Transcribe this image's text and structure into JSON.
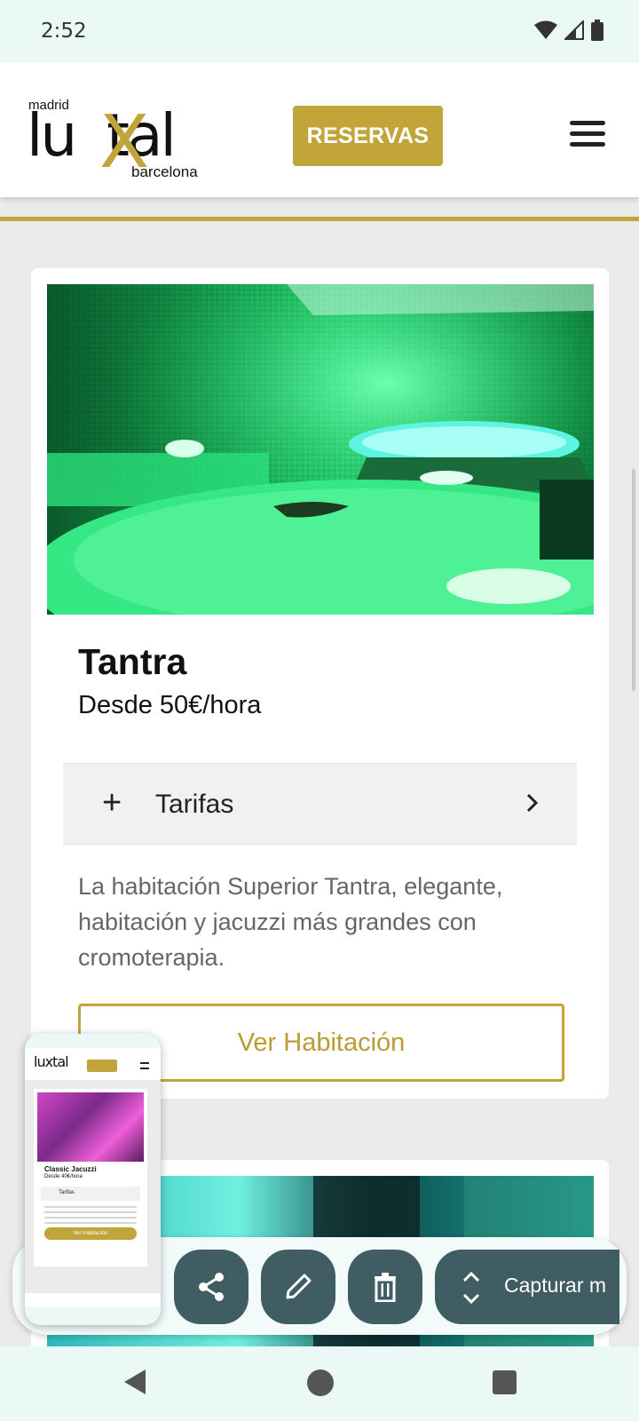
{
  "status_bar": {
    "time": "2:52"
  },
  "header": {
    "logo": {
      "top_text": "madrid",
      "brand": "luxtal",
      "bottom_text": "barcelona"
    },
    "reservas_label": "RESERVAS",
    "menu_icon": "hamburger-menu-icon"
  },
  "colors": {
    "accent_gold": "#c1a53b",
    "toolbar_button": "#3f5d62",
    "system_bar": "#eaf8f6"
  },
  "room_card": {
    "title": "Tantra",
    "price": "Desde 50€/hora",
    "tarifas": {
      "expand_icon": "plus-icon",
      "label": "Tarifas",
      "chevron": "chevron-right-icon"
    },
    "description": "La habitación Superior Tantra, elegante, habitación y jacuzzi más grandes con cromoterapia.",
    "view_button": "Ver Habitación"
  },
  "screenshot_toolbar": {
    "share_icon": "share-icon",
    "edit_icon": "pencil-icon",
    "delete_icon": "trash-icon",
    "capture_label": "Capturar m"
  },
  "thumbnail": {
    "logo": "luxtal",
    "room_title": "Classic Jacuzzi",
    "room_price": "Desde 40€/hora",
    "tarifas_label": "Tarifas",
    "button_label": "Ver Habitación"
  },
  "nav_bar": {
    "back_icon": "back-triangle-icon",
    "home_icon": "home-circle-icon",
    "recents_icon": "recents-square-icon"
  }
}
